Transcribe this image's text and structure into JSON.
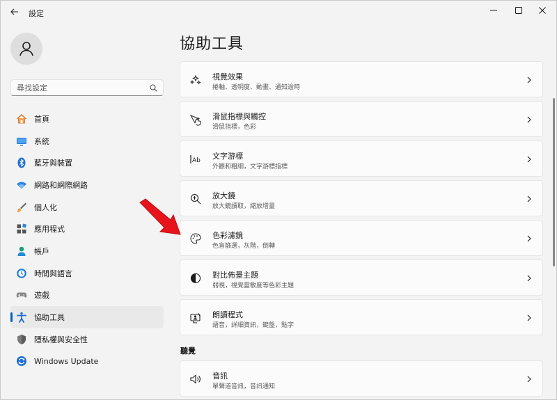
{
  "window": {
    "title": "設定",
    "back_label": "←",
    "minimize_label": "—",
    "maximize_label": "□",
    "close_label": "✕"
  },
  "sidebar": {
    "search_placeholder": "尋找設定",
    "items": [
      {
        "label": "首頁",
        "icon": "home-icon",
        "active": false
      },
      {
        "label": "系統",
        "icon": "monitor-icon",
        "active": false
      },
      {
        "label": "藍牙與裝置",
        "icon": "bluetooth-icon",
        "active": false
      },
      {
        "label": "網路和網際網路",
        "icon": "wifi-icon",
        "active": false
      },
      {
        "label": "個人化",
        "icon": "brush-icon",
        "active": false
      },
      {
        "label": "應用程式",
        "icon": "apps-icon",
        "active": false
      },
      {
        "label": "帳戶",
        "icon": "account-icon",
        "active": false
      },
      {
        "label": "時間與語言",
        "icon": "globe-clock-icon",
        "active": false
      },
      {
        "label": "遊戲",
        "icon": "gamepad-icon",
        "active": false
      },
      {
        "label": "協助工具",
        "icon": "accessibility-icon",
        "active": true
      },
      {
        "label": "隱私權與安全性",
        "icon": "shield-icon",
        "active": false
      },
      {
        "label": "Windows Update",
        "icon": "update-icon",
        "active": false
      }
    ]
  },
  "main": {
    "title": "協助工具",
    "cards": [
      {
        "title": "視覺效果",
        "subtitle": "捲軸、透明度、動畫、通知逾時",
        "icon": "sparkle-icon"
      },
      {
        "title": "滑鼠指標與觸控",
        "subtitle": "滑鼠指標，色彩",
        "icon": "pointer-touch-icon"
      },
      {
        "title": "文字游標",
        "subtitle": "外觀和粗細，文字游標指標",
        "icon": "text-cursor-icon"
      },
      {
        "title": "放大鏡",
        "subtitle": "放大鏡讀取，縮放增量",
        "icon": "magnifier-icon"
      },
      {
        "title": "色彩濾鏡",
        "subtitle": "色盲篩選，灰階，倒轉",
        "icon": "palette-icon"
      },
      {
        "title": "對比佈景主題",
        "subtitle": "弱視，視覺靈敏度等色彩主題",
        "icon": "contrast-icon"
      },
      {
        "title": "朗讀程式",
        "subtitle": "語音，詳細資訊，鍵盤，點字",
        "icon": "narrator-icon"
      }
    ],
    "section_hearing": "聽覺",
    "hearing_cards": [
      {
        "title": "音訊",
        "subtitle": "單聲道音訊，音訊通知",
        "icon": "speaker-icon"
      }
    ]
  },
  "colors": {
    "accent": "#005fb8",
    "annotation_arrow": "#e8141b",
    "window_bg": "#f3f3f3",
    "card_bg": "#fbfbfb"
  }
}
